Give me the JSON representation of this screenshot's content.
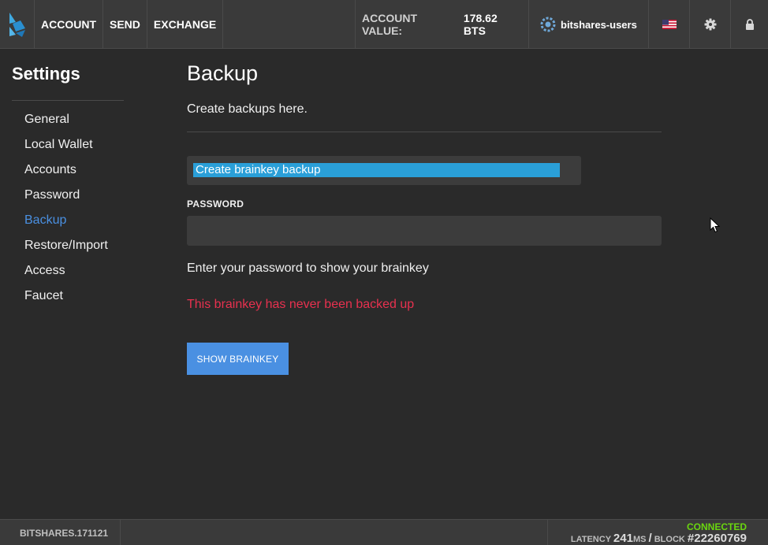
{
  "header": {
    "nav": [
      {
        "label": "ACCOUNT"
      },
      {
        "label": "SEND"
      },
      {
        "label": "EXCHANGE"
      }
    ],
    "account_value_label": "ACCOUNT VALUE:",
    "account_value_amount": "178.62 BTS",
    "account_name": "bitshares-users",
    "icons": [
      "bitshares-logo-icon",
      "flag-us-icon",
      "gear-icon",
      "lock-icon"
    ]
  },
  "sidebar": {
    "title": "Settings",
    "items": [
      {
        "label": "General"
      },
      {
        "label": "Local Wallet"
      },
      {
        "label": "Accounts"
      },
      {
        "label": "Password"
      },
      {
        "label": "Backup",
        "active": true
      },
      {
        "label": "Restore/Import"
      },
      {
        "label": "Access"
      },
      {
        "label": "Faucet"
      }
    ]
  },
  "main": {
    "title": "Backup",
    "subtitle": "Create backups here.",
    "backup_type_selected": "Create brainkey backup",
    "password_label": "PASSWORD",
    "password_value": "",
    "hint": "Enter your password to show your brainkey",
    "warning": "This brainkey has never been backed up",
    "show_button_label": "SHOW BRAINKEY"
  },
  "footer": {
    "version": "BITSHARES.171121",
    "connection_status": "CONNECTED",
    "latency_label": "LATENCY",
    "latency_value": "241",
    "latency_unit": "MS",
    "block_label": "BLOCK",
    "block_value": "#22260769"
  },
  "colors": {
    "accent": "#4a90e2",
    "selection": "#2a9fd8",
    "warning": "#e8314f",
    "connected": "#6ad60f"
  }
}
